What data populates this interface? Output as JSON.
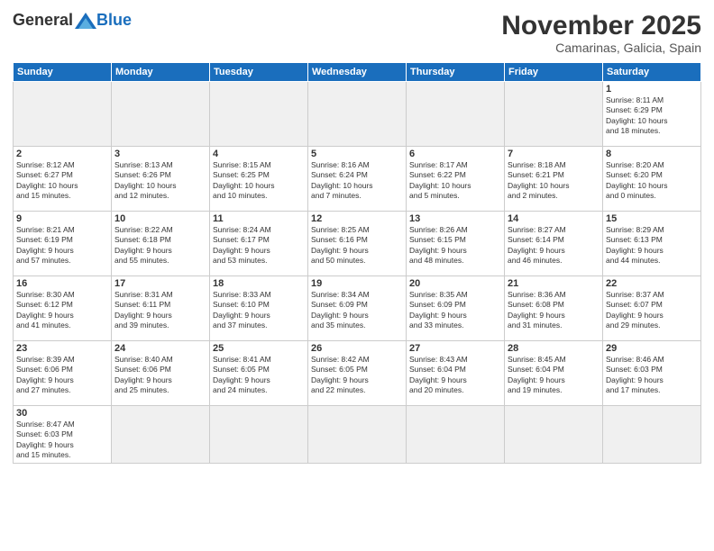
{
  "header": {
    "logo_general": "General",
    "logo_blue": "Blue",
    "month_title": "November 2025",
    "location": "Camarinas, Galicia, Spain"
  },
  "weekdays": [
    "Sunday",
    "Monday",
    "Tuesday",
    "Wednesday",
    "Thursday",
    "Friday",
    "Saturday"
  ],
  "weeks": [
    [
      {
        "day": "",
        "info": ""
      },
      {
        "day": "",
        "info": ""
      },
      {
        "day": "",
        "info": ""
      },
      {
        "day": "",
        "info": ""
      },
      {
        "day": "",
        "info": ""
      },
      {
        "day": "",
        "info": ""
      },
      {
        "day": "1",
        "info": "Sunrise: 8:11 AM\nSunset: 6:29 PM\nDaylight: 10 hours\nand 18 minutes."
      }
    ],
    [
      {
        "day": "2",
        "info": "Sunrise: 8:12 AM\nSunset: 6:27 PM\nDaylight: 10 hours\nand 15 minutes."
      },
      {
        "day": "3",
        "info": "Sunrise: 8:13 AM\nSunset: 6:26 PM\nDaylight: 10 hours\nand 12 minutes."
      },
      {
        "day": "4",
        "info": "Sunrise: 8:15 AM\nSunset: 6:25 PM\nDaylight: 10 hours\nand 10 minutes."
      },
      {
        "day": "5",
        "info": "Sunrise: 8:16 AM\nSunset: 6:24 PM\nDaylight: 10 hours\nand 7 minutes."
      },
      {
        "day": "6",
        "info": "Sunrise: 8:17 AM\nSunset: 6:22 PM\nDaylight: 10 hours\nand 5 minutes."
      },
      {
        "day": "7",
        "info": "Sunrise: 8:18 AM\nSunset: 6:21 PM\nDaylight: 10 hours\nand 2 minutes."
      },
      {
        "day": "8",
        "info": "Sunrise: 8:20 AM\nSunset: 6:20 PM\nDaylight: 10 hours\nand 0 minutes."
      }
    ],
    [
      {
        "day": "9",
        "info": "Sunrise: 8:21 AM\nSunset: 6:19 PM\nDaylight: 9 hours\nand 57 minutes."
      },
      {
        "day": "10",
        "info": "Sunrise: 8:22 AM\nSunset: 6:18 PM\nDaylight: 9 hours\nand 55 minutes."
      },
      {
        "day": "11",
        "info": "Sunrise: 8:24 AM\nSunset: 6:17 PM\nDaylight: 9 hours\nand 53 minutes."
      },
      {
        "day": "12",
        "info": "Sunrise: 8:25 AM\nSunset: 6:16 PM\nDaylight: 9 hours\nand 50 minutes."
      },
      {
        "day": "13",
        "info": "Sunrise: 8:26 AM\nSunset: 6:15 PM\nDaylight: 9 hours\nand 48 minutes."
      },
      {
        "day": "14",
        "info": "Sunrise: 8:27 AM\nSunset: 6:14 PM\nDaylight: 9 hours\nand 46 minutes."
      },
      {
        "day": "15",
        "info": "Sunrise: 8:29 AM\nSunset: 6:13 PM\nDaylight: 9 hours\nand 44 minutes."
      }
    ],
    [
      {
        "day": "16",
        "info": "Sunrise: 8:30 AM\nSunset: 6:12 PM\nDaylight: 9 hours\nand 41 minutes."
      },
      {
        "day": "17",
        "info": "Sunrise: 8:31 AM\nSunset: 6:11 PM\nDaylight: 9 hours\nand 39 minutes."
      },
      {
        "day": "18",
        "info": "Sunrise: 8:33 AM\nSunset: 6:10 PM\nDaylight: 9 hours\nand 37 minutes."
      },
      {
        "day": "19",
        "info": "Sunrise: 8:34 AM\nSunset: 6:09 PM\nDaylight: 9 hours\nand 35 minutes."
      },
      {
        "day": "20",
        "info": "Sunrise: 8:35 AM\nSunset: 6:09 PM\nDaylight: 9 hours\nand 33 minutes."
      },
      {
        "day": "21",
        "info": "Sunrise: 8:36 AM\nSunset: 6:08 PM\nDaylight: 9 hours\nand 31 minutes."
      },
      {
        "day": "22",
        "info": "Sunrise: 8:37 AM\nSunset: 6:07 PM\nDaylight: 9 hours\nand 29 minutes."
      }
    ],
    [
      {
        "day": "23",
        "info": "Sunrise: 8:39 AM\nSunset: 6:06 PM\nDaylight: 9 hours\nand 27 minutes."
      },
      {
        "day": "24",
        "info": "Sunrise: 8:40 AM\nSunset: 6:06 PM\nDaylight: 9 hours\nand 25 minutes."
      },
      {
        "day": "25",
        "info": "Sunrise: 8:41 AM\nSunset: 6:05 PM\nDaylight: 9 hours\nand 24 minutes."
      },
      {
        "day": "26",
        "info": "Sunrise: 8:42 AM\nSunset: 6:05 PM\nDaylight: 9 hours\nand 22 minutes."
      },
      {
        "day": "27",
        "info": "Sunrise: 8:43 AM\nSunset: 6:04 PM\nDaylight: 9 hours\nand 20 minutes."
      },
      {
        "day": "28",
        "info": "Sunrise: 8:45 AM\nSunset: 6:04 PM\nDaylight: 9 hours\nand 19 minutes."
      },
      {
        "day": "29",
        "info": "Sunrise: 8:46 AM\nSunset: 6:03 PM\nDaylight: 9 hours\nand 17 minutes."
      }
    ],
    [
      {
        "day": "30",
        "info": "Sunrise: 8:47 AM\nSunset: 6:03 PM\nDaylight: 9 hours\nand 15 minutes."
      },
      {
        "day": "",
        "info": ""
      },
      {
        "day": "",
        "info": ""
      },
      {
        "day": "",
        "info": ""
      },
      {
        "day": "",
        "info": ""
      },
      {
        "day": "",
        "info": ""
      },
      {
        "day": "",
        "info": ""
      }
    ]
  ]
}
